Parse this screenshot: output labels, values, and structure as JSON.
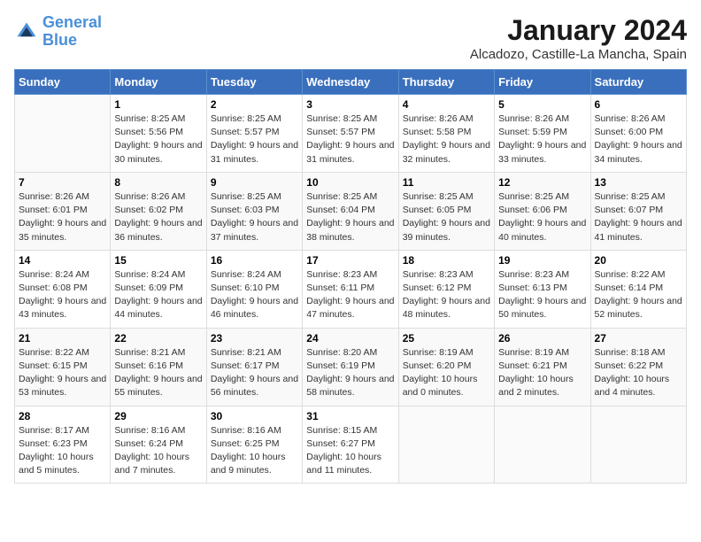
{
  "header": {
    "logo_line1": "General",
    "logo_line2": "Blue",
    "month_year": "January 2024",
    "location": "Alcadozo, Castille-La Mancha, Spain"
  },
  "weekdays": [
    "Sunday",
    "Monday",
    "Tuesday",
    "Wednesday",
    "Thursday",
    "Friday",
    "Saturday"
  ],
  "weeks": [
    [
      {
        "day": "",
        "sunrise": "",
        "sunset": "",
        "daylight": ""
      },
      {
        "day": "1",
        "sunrise": "Sunrise: 8:25 AM",
        "sunset": "Sunset: 5:56 PM",
        "daylight": "Daylight: 9 hours and 30 minutes."
      },
      {
        "day": "2",
        "sunrise": "Sunrise: 8:25 AM",
        "sunset": "Sunset: 5:57 PM",
        "daylight": "Daylight: 9 hours and 31 minutes."
      },
      {
        "day": "3",
        "sunrise": "Sunrise: 8:25 AM",
        "sunset": "Sunset: 5:57 PM",
        "daylight": "Daylight: 9 hours and 31 minutes."
      },
      {
        "day": "4",
        "sunrise": "Sunrise: 8:26 AM",
        "sunset": "Sunset: 5:58 PM",
        "daylight": "Daylight: 9 hours and 32 minutes."
      },
      {
        "day": "5",
        "sunrise": "Sunrise: 8:26 AM",
        "sunset": "Sunset: 5:59 PM",
        "daylight": "Daylight: 9 hours and 33 minutes."
      },
      {
        "day": "6",
        "sunrise": "Sunrise: 8:26 AM",
        "sunset": "Sunset: 6:00 PM",
        "daylight": "Daylight: 9 hours and 34 minutes."
      }
    ],
    [
      {
        "day": "7",
        "sunrise": "Sunrise: 8:26 AM",
        "sunset": "Sunset: 6:01 PM",
        "daylight": "Daylight: 9 hours and 35 minutes."
      },
      {
        "day": "8",
        "sunrise": "Sunrise: 8:26 AM",
        "sunset": "Sunset: 6:02 PM",
        "daylight": "Daylight: 9 hours and 36 minutes."
      },
      {
        "day": "9",
        "sunrise": "Sunrise: 8:25 AM",
        "sunset": "Sunset: 6:03 PM",
        "daylight": "Daylight: 9 hours and 37 minutes."
      },
      {
        "day": "10",
        "sunrise": "Sunrise: 8:25 AM",
        "sunset": "Sunset: 6:04 PM",
        "daylight": "Daylight: 9 hours and 38 minutes."
      },
      {
        "day": "11",
        "sunrise": "Sunrise: 8:25 AM",
        "sunset": "Sunset: 6:05 PM",
        "daylight": "Daylight: 9 hours and 39 minutes."
      },
      {
        "day": "12",
        "sunrise": "Sunrise: 8:25 AM",
        "sunset": "Sunset: 6:06 PM",
        "daylight": "Daylight: 9 hours and 40 minutes."
      },
      {
        "day": "13",
        "sunrise": "Sunrise: 8:25 AM",
        "sunset": "Sunset: 6:07 PM",
        "daylight": "Daylight: 9 hours and 41 minutes."
      }
    ],
    [
      {
        "day": "14",
        "sunrise": "Sunrise: 8:24 AM",
        "sunset": "Sunset: 6:08 PM",
        "daylight": "Daylight: 9 hours and 43 minutes."
      },
      {
        "day": "15",
        "sunrise": "Sunrise: 8:24 AM",
        "sunset": "Sunset: 6:09 PM",
        "daylight": "Daylight: 9 hours and 44 minutes."
      },
      {
        "day": "16",
        "sunrise": "Sunrise: 8:24 AM",
        "sunset": "Sunset: 6:10 PM",
        "daylight": "Daylight: 9 hours and 46 minutes."
      },
      {
        "day": "17",
        "sunrise": "Sunrise: 8:23 AM",
        "sunset": "Sunset: 6:11 PM",
        "daylight": "Daylight: 9 hours and 47 minutes."
      },
      {
        "day": "18",
        "sunrise": "Sunrise: 8:23 AM",
        "sunset": "Sunset: 6:12 PM",
        "daylight": "Daylight: 9 hours and 48 minutes."
      },
      {
        "day": "19",
        "sunrise": "Sunrise: 8:23 AM",
        "sunset": "Sunset: 6:13 PM",
        "daylight": "Daylight: 9 hours and 50 minutes."
      },
      {
        "day": "20",
        "sunrise": "Sunrise: 8:22 AM",
        "sunset": "Sunset: 6:14 PM",
        "daylight": "Daylight: 9 hours and 52 minutes."
      }
    ],
    [
      {
        "day": "21",
        "sunrise": "Sunrise: 8:22 AM",
        "sunset": "Sunset: 6:15 PM",
        "daylight": "Daylight: 9 hours and 53 minutes."
      },
      {
        "day": "22",
        "sunrise": "Sunrise: 8:21 AM",
        "sunset": "Sunset: 6:16 PM",
        "daylight": "Daylight: 9 hours and 55 minutes."
      },
      {
        "day": "23",
        "sunrise": "Sunrise: 8:21 AM",
        "sunset": "Sunset: 6:17 PM",
        "daylight": "Daylight: 9 hours and 56 minutes."
      },
      {
        "day": "24",
        "sunrise": "Sunrise: 8:20 AM",
        "sunset": "Sunset: 6:19 PM",
        "daylight": "Daylight: 9 hours and 58 minutes."
      },
      {
        "day": "25",
        "sunrise": "Sunrise: 8:19 AM",
        "sunset": "Sunset: 6:20 PM",
        "daylight": "Daylight: 10 hours and 0 minutes."
      },
      {
        "day": "26",
        "sunrise": "Sunrise: 8:19 AM",
        "sunset": "Sunset: 6:21 PM",
        "daylight": "Daylight: 10 hours and 2 minutes."
      },
      {
        "day": "27",
        "sunrise": "Sunrise: 8:18 AM",
        "sunset": "Sunset: 6:22 PM",
        "daylight": "Daylight: 10 hours and 4 minutes."
      }
    ],
    [
      {
        "day": "28",
        "sunrise": "Sunrise: 8:17 AM",
        "sunset": "Sunset: 6:23 PM",
        "daylight": "Daylight: 10 hours and 5 minutes."
      },
      {
        "day": "29",
        "sunrise": "Sunrise: 8:16 AM",
        "sunset": "Sunset: 6:24 PM",
        "daylight": "Daylight: 10 hours and 7 minutes."
      },
      {
        "day": "30",
        "sunrise": "Sunrise: 8:16 AM",
        "sunset": "Sunset: 6:25 PM",
        "daylight": "Daylight: 10 hours and 9 minutes."
      },
      {
        "day": "31",
        "sunrise": "Sunrise: 8:15 AM",
        "sunset": "Sunset: 6:27 PM",
        "daylight": "Daylight: 10 hours and 11 minutes."
      },
      {
        "day": "",
        "sunrise": "",
        "sunset": "",
        "daylight": ""
      },
      {
        "day": "",
        "sunrise": "",
        "sunset": "",
        "daylight": ""
      },
      {
        "day": "",
        "sunrise": "",
        "sunset": "",
        "daylight": ""
      }
    ]
  ]
}
